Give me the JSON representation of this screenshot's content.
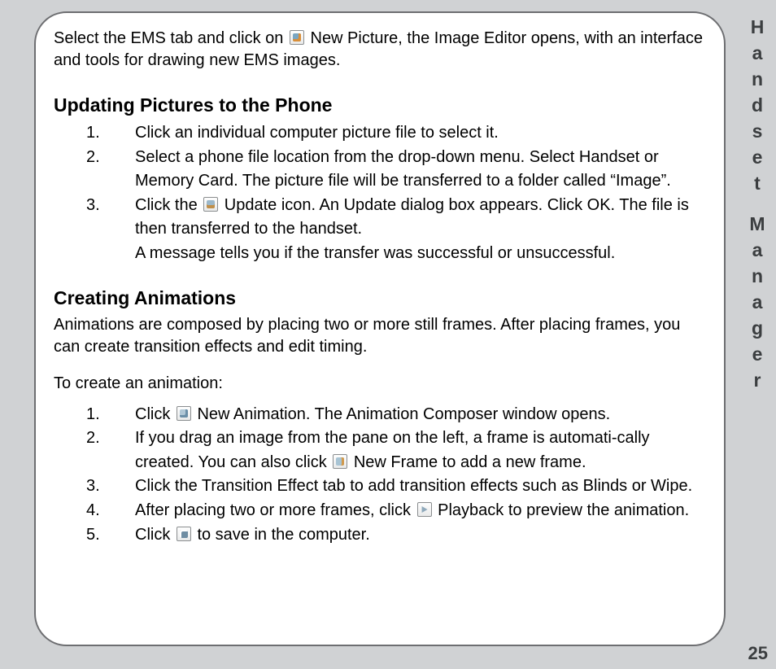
{
  "sidebar": {
    "title_word1": "Handset",
    "title_word2": "Manager"
  },
  "page_number": "25",
  "intro": {
    "part1": "Select the EMS tab and click on ",
    "part2": " New Picture, the Image Editor opens, with an interface and tools for drawing new EMS images."
  },
  "section1": {
    "heading": "Updating Pictures to the Phone",
    "items": [
      {
        "num": "1.",
        "text": "Click an individual computer picture file to select it."
      },
      {
        "num": "2.",
        "text": "Select a phone file location from the drop-down menu. Select Handset or Memory Card. The picture file will be transferred  to a folder called “Image”."
      },
      {
        "num": "3.",
        "pre": "Click the ",
        "post": " Update icon. An Update dialog box appears. Click OK. The file is then transferred to the handset.",
        "extra": "A message tells you if the transfer was successful or unsuccessful."
      }
    ]
  },
  "section2": {
    "heading": "Creating Animations",
    "intro": "Animations are composed by placing two or more still frames. After placing frames, you can create transition effects and edit timing.",
    "sub": "To create an animation:",
    "items": [
      {
        "num": "1.",
        "pre": "Click  ",
        "post": " New Animation. The Animation Composer window opens."
      },
      {
        "num": "2.",
        "pre": "If you drag an image from the pane on the left, a frame is automati-cally created. You can also click ",
        "post": " New Frame to add a new frame."
      },
      {
        "num": "3.",
        "text": "Click the Transition Effect tab to add transition effects  such as Blinds or Wipe."
      },
      {
        "num": "4.",
        "pre": "After placing two or more frames, click ",
        "post": " Playback to preview the animation."
      },
      {
        "num": "5.",
        "pre": "Click ",
        "post": " to save in the computer."
      }
    ]
  }
}
